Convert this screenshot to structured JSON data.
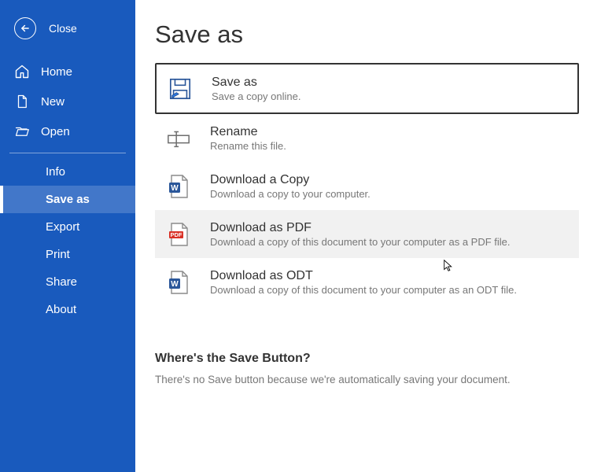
{
  "close_label": "Close",
  "nav_primary": [
    {
      "id": "home",
      "label": "Home",
      "icon": "home-icon"
    },
    {
      "id": "new",
      "label": "New",
      "icon": "file-icon"
    },
    {
      "id": "open",
      "label": "Open",
      "icon": "folder-open-icon"
    }
  ],
  "nav_secondary": [
    {
      "id": "info",
      "label": "Info"
    },
    {
      "id": "saveas",
      "label": "Save as",
      "selected": true
    },
    {
      "id": "export",
      "label": "Export"
    },
    {
      "id": "print",
      "label": "Print"
    },
    {
      "id": "share",
      "label": "Share"
    },
    {
      "id": "about",
      "label": "About"
    }
  ],
  "page_title": "Save as",
  "options": [
    {
      "id": "saveas",
      "title": "Save as",
      "sub": "Save a copy online.",
      "icon": "save-disk-icon",
      "outlined": true
    },
    {
      "id": "rename",
      "title": "Rename",
      "sub": "Rename this file.",
      "icon": "rename-icon"
    },
    {
      "id": "download",
      "title": "Download a Copy",
      "sub": "Download a copy to your computer.",
      "icon": "word-doc-icon"
    },
    {
      "id": "pdf",
      "title": "Download as PDF",
      "sub": "Download a copy of this document to your computer as a PDF file.",
      "icon": "pdf-icon",
      "hover": true
    },
    {
      "id": "odt",
      "title": "Download as ODT",
      "sub": "Download a copy of this document to your computer as an ODT file.",
      "icon": "word-doc-icon"
    }
  ],
  "help_title": "Where's the Save Button?",
  "help_text": "There's no Save button because we're automatically saving your document."
}
